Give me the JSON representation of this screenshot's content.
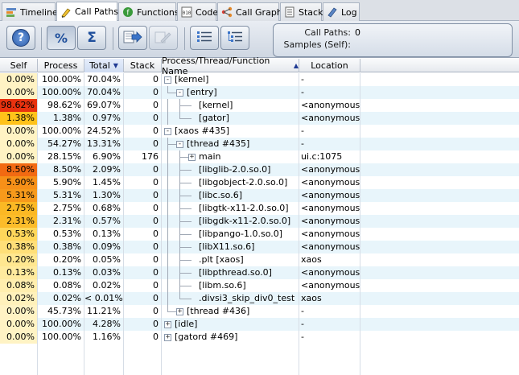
{
  "tabs": [
    {
      "label": "Timeline",
      "icon": "timeline-icon",
      "active": false
    },
    {
      "label": "Call Paths",
      "icon": "call-paths-icon",
      "active": true
    },
    {
      "label": "Functions",
      "icon": "functions-icon",
      "active": false
    },
    {
      "label": "Code",
      "icon": "code-icon",
      "active": false
    },
    {
      "label": "Call Graph",
      "icon": "call-graph-icon",
      "active": false
    },
    {
      "label": "Stack",
      "icon": "stack-icon",
      "active": false
    },
    {
      "label": "Log",
      "icon": "log-icon",
      "active": false
    }
  ],
  "toolbar": {
    "help": "?",
    "percent": "%",
    "sigma": "Σ",
    "info": {
      "call_paths_label": "Call Paths:",
      "call_paths_value": "0",
      "samples_label": "Samples (Self):",
      "samples_value": ""
    }
  },
  "columns": [
    "Self",
    "Process",
    "Total",
    "Stack",
    "Process/Thread/Function Name",
    "Location"
  ],
  "rows": [
    {
      "self": "0.00%",
      "process": "100.00%",
      "total": "70.04%",
      "stack": "0",
      "name": "[kernel]",
      "location": "-",
      "depth": 0,
      "toggle": "-",
      "heat": "#fff3c4"
    },
    {
      "self": "0.00%",
      "process": "100.00%",
      "total": "70.04%",
      "stack": "0",
      "name": "[entry]",
      "location": "-",
      "depth": 1,
      "toggle": "-",
      "heat": "#fff3c4"
    },
    {
      "self": "98.62%",
      "process": "98.62%",
      "total": "69.07%",
      "stack": "0",
      "name": "[kernel]",
      "location": "<anonymous>",
      "depth": 2,
      "toggle": "",
      "heat": "#e8320f"
    },
    {
      "self": "1.38%",
      "process": "1.38%",
      "total": "0.97%",
      "stack": "0",
      "name": "[gator]",
      "location": "<anonymous>",
      "depth": 2,
      "toggle": "",
      "heat": "#ffc21a"
    },
    {
      "self": "0.00%",
      "process": "100.00%",
      "total": "24.52%",
      "stack": "0",
      "name": "[xaos #435]",
      "location": "-",
      "depth": 0,
      "toggle": "-",
      "heat": "#fff3c4"
    },
    {
      "self": "0.00%",
      "process": "54.27%",
      "total": "13.31%",
      "stack": "0",
      "name": "[thread #435]",
      "location": "-",
      "depth": 1,
      "toggle": "-",
      "heat": "#fff3c4"
    },
    {
      "self": "0.00%",
      "process": "28.15%",
      "total": "6.90%",
      "stack": "176",
      "name": "main",
      "location": "ui.c:1075",
      "depth": 2,
      "toggle": "+",
      "heat": "#fff3c4"
    },
    {
      "self": "8.50%",
      "process": "8.50%",
      "total": "2.09%",
      "stack": "0",
      "name": "[libglib-2.0.so.0]",
      "location": "<anonymous>",
      "depth": 2,
      "toggle": "",
      "heat": "#f26a12"
    },
    {
      "self": "5.90%",
      "process": "5.90%",
      "total": "1.45%",
      "stack": "0",
      "name": "[libgobject-2.0.so.0]",
      "location": "<anonymous>",
      "depth": 2,
      "toggle": "",
      "heat": "#f79018"
    },
    {
      "self": "5.31%",
      "process": "5.31%",
      "total": "1.30%",
      "stack": "0",
      "name": "[libc.so.6]",
      "location": "<anonymous>",
      "depth": 2,
      "toggle": "",
      "heat": "#f79a1b"
    },
    {
      "self": "2.75%",
      "process": "2.75%",
      "total": "0.68%",
      "stack": "0",
      "name": "[libgtk-x11-2.0.so.0]",
      "location": "<anonymous>",
      "depth": 2,
      "toggle": "",
      "heat": "#fbb824"
    },
    {
      "self": "2.31%",
      "process": "2.31%",
      "total": "0.57%",
      "stack": "0",
      "name": "[libgdk-x11-2.0.so.0]",
      "location": "<anonymous>",
      "depth": 2,
      "toggle": "",
      "heat": "#fcbc2a"
    },
    {
      "self": "0.53%",
      "process": "0.53%",
      "total": "0.13%",
      "stack": "0",
      "name": "[libpango-1.0.so.0]",
      "location": "<anonymous>",
      "depth": 2,
      "toggle": "",
      "heat": "#ffd75a"
    },
    {
      "self": "0.38%",
      "process": "0.38%",
      "total": "0.09%",
      "stack": "0",
      "name": "[libX11.so.6]",
      "location": "<anonymous>",
      "depth": 2,
      "toggle": "",
      "heat": "#ffdf78"
    },
    {
      "self": "0.20%",
      "process": "0.20%",
      "total": "0.05%",
      "stack": "0",
      "name": ".plt [xaos]",
      "location": "xaos",
      "depth": 2,
      "toggle": "",
      "heat": "#ffe790"
    },
    {
      "self": "0.13%",
      "process": "0.13%",
      "total": "0.03%",
      "stack": "0",
      "name": "[libpthread.so.0]",
      "location": "<anonymous>",
      "depth": 2,
      "toggle": "",
      "heat": "#ffeb9e"
    },
    {
      "self": "0.08%",
      "process": "0.08%",
      "total": "0.02%",
      "stack": "0",
      "name": "[libm.so.6]",
      "location": "<anonymous>",
      "depth": 2,
      "toggle": "",
      "heat": "#ffeeae"
    },
    {
      "self": "0.02%",
      "process": "0.02%",
      "total": "< 0.01%",
      "stack": "0",
      "name": ".divsi3_skip_div0_test",
      "location": "xaos",
      "depth": 2,
      "toggle": "",
      "heat": "#fff1bb"
    },
    {
      "self": "0.00%",
      "process": "45.73%",
      "total": "11.21%",
      "stack": "0",
      "name": "[thread #436]",
      "location": "-",
      "depth": 1,
      "toggle": "+",
      "heat": "#fff3c4"
    },
    {
      "self": "0.00%",
      "process": "100.00%",
      "total": "4.28%",
      "stack": "0",
      "name": "[idle]",
      "location": "-",
      "depth": 0,
      "toggle": "+",
      "heat": "#fff3c4"
    },
    {
      "self": "0.00%",
      "process": "100.00%",
      "total": "1.16%",
      "stack": "0",
      "name": "[gatord #469]",
      "location": "-",
      "depth": 0,
      "toggle": "+",
      "heat": "#fff3c4"
    }
  ]
}
